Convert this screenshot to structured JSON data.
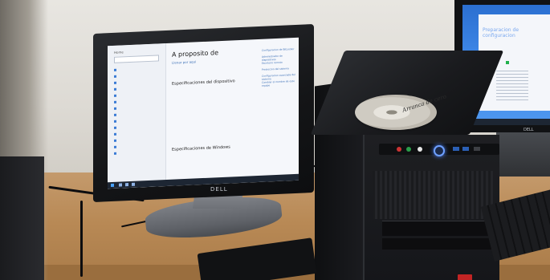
{
  "scene": {
    "description_free": true
  },
  "left_monitor": {
    "brand": "DELL",
    "settings_window": {
      "sidebar_title": "Home",
      "heading": "A proposito de",
      "subheading": "Llenar por aqui",
      "section_title": "Especificaciones del dispositivo",
      "secondary_title": "Especificaciones de Windows",
      "links": [
        "Configuracion de BitLocker",
        "Administrador de dispositivos",
        "Escritorio remoto",
        "Proteccion del sistema",
        "Configuracion avanzada del sistema",
        "Cambiar el nombre de este equipo"
      ]
    }
  },
  "right_monitor": {
    "brand": "DELL",
    "window_title": "Preparacion de configuracion"
  },
  "disc": {
    "handwriting": "Arranca de cero"
  },
  "colors": {
    "power_led": "#4f86ff",
    "desktop_blue": "#3d86e6",
    "desk_wood": "#b88955"
  }
}
